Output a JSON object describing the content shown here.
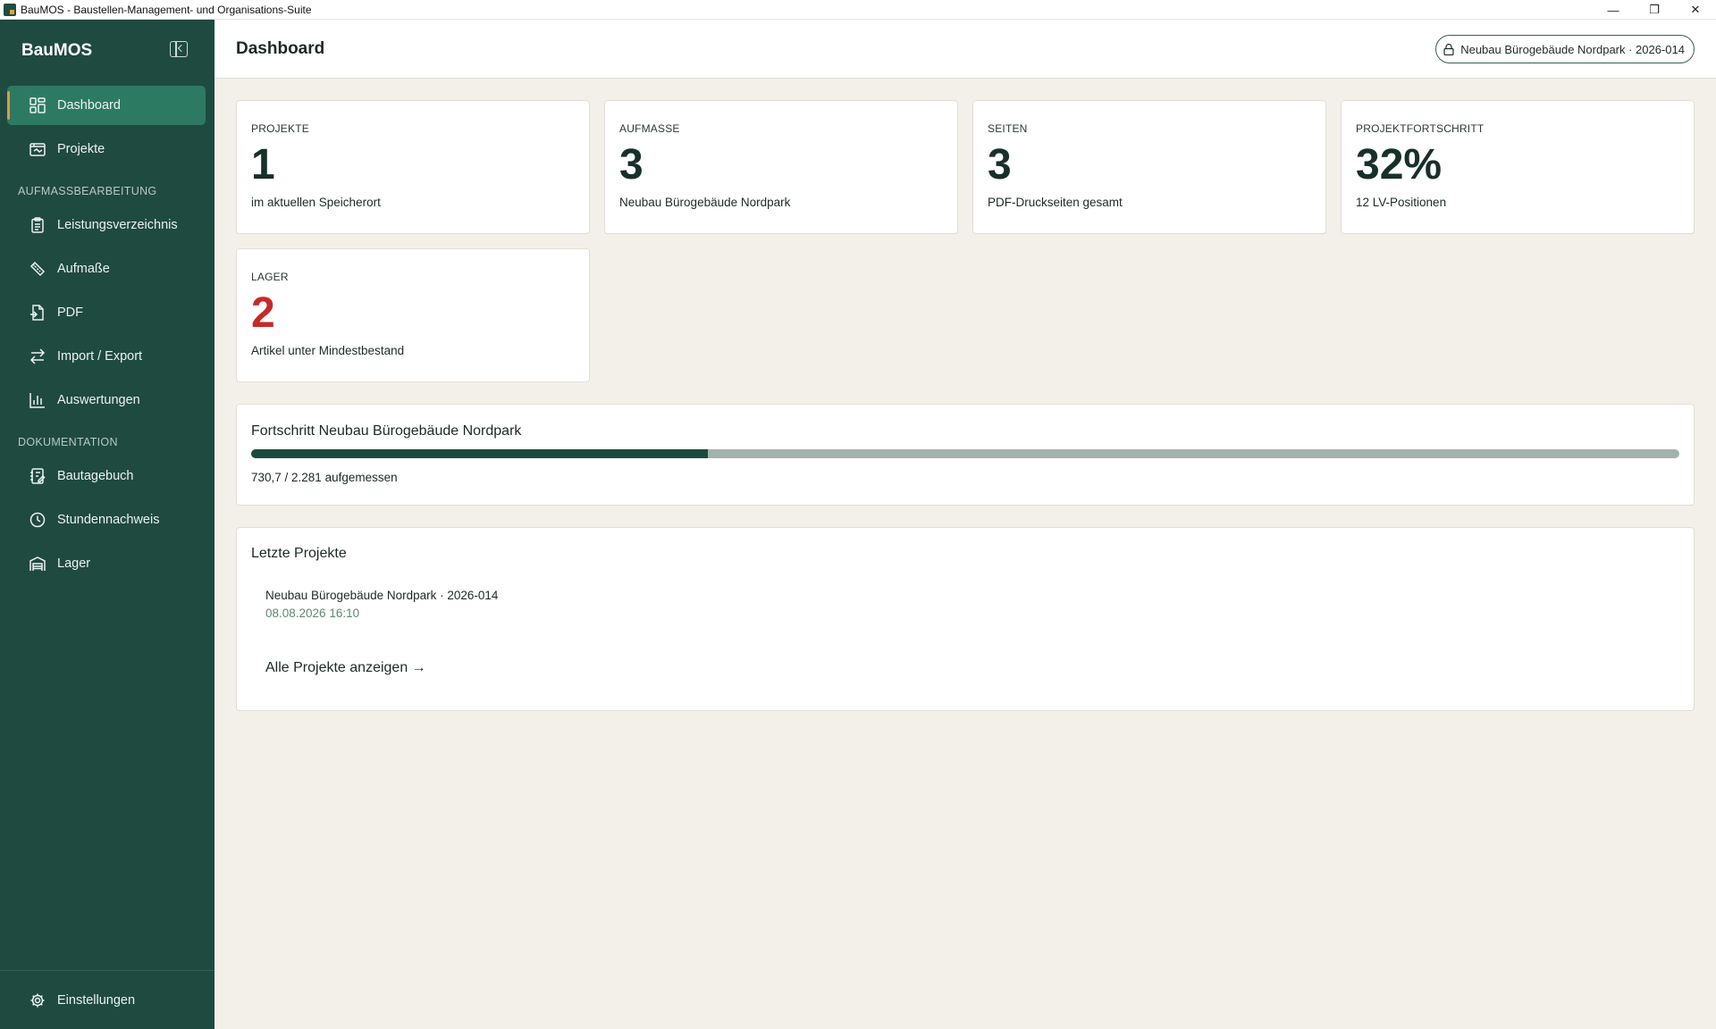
{
  "window": {
    "title": "BauMOS - Baustellen-Management- und Organisations-Suite",
    "minimize": "—",
    "maximize": "❐",
    "close": "✕"
  },
  "sidebar": {
    "brand": "BauMOS",
    "items": [
      {
        "label": "Dashboard",
        "icon": "dashboard-icon",
        "active": true
      },
      {
        "label": "Projekte",
        "icon": "projects-icon",
        "active": false
      }
    ],
    "sections": [
      {
        "label": "AUFMASSBEARBEITUNG",
        "items": [
          {
            "label": "Leistungsverzeichnis",
            "icon": "clipboard-icon"
          },
          {
            "label": "Aufmaße",
            "icon": "ruler-icon"
          },
          {
            "label": "PDF",
            "icon": "pdf-file-icon"
          },
          {
            "label": "Import / Export",
            "icon": "arrows-swap-icon"
          },
          {
            "label": "Auswertungen",
            "icon": "bar-chart-icon"
          }
        ]
      },
      {
        "label": "DOKUMENTATION",
        "items": [
          {
            "label": "Bautagebuch",
            "icon": "notebook-icon"
          },
          {
            "label": "Stundennachweis",
            "icon": "clock-icon"
          },
          {
            "label": "Lager",
            "icon": "warehouse-icon"
          }
        ]
      }
    ],
    "settings": {
      "label": "Einstellungen",
      "icon": "gear-icon"
    }
  },
  "header": {
    "title": "Dashboard",
    "project_pill": "Neubau Bürogebäude Nordpark · 2026-014"
  },
  "stats": [
    {
      "label": "PROJEKTE",
      "value": "1",
      "sub": "im aktuellen Speicherort"
    },
    {
      "label": "AUFMASSE",
      "value": "3",
      "sub": "Neubau Bürogebäude Nordpark"
    },
    {
      "label": "SEITEN",
      "value": "3",
      "sub": "PDF-Druckseiten gesamt"
    },
    {
      "label": "PROJEKTFORTSCHRITT",
      "value": "32%",
      "sub": "12 LV-Positionen"
    },
    {
      "label": "LAGER",
      "value": "2",
      "sub": "Artikel unter Mindestbestand",
      "alert_color": "#c62a28"
    }
  ],
  "progress": {
    "title": "Fortschritt Neubau Bürogebäude Nordpark",
    "fraction": 0.32,
    "text": "730,7 / 2.281 aufgemessen"
  },
  "recent": {
    "title": "Letzte Projekte",
    "items": [
      {
        "name": "Neubau Bürogebäude Nordpark · 2026-014",
        "date": "08.08.2026 16:10"
      }
    ],
    "all_link": "Alle Projekte anzeigen →"
  },
  "colors": {
    "sidebar": "#1f4a40",
    "active_item": "#2d7a63",
    "accent": "#e09a3c",
    "progress_fill": "#1b4a3e",
    "progress_track": "#a3b2ad",
    "background": "#f3f0ea"
  }
}
